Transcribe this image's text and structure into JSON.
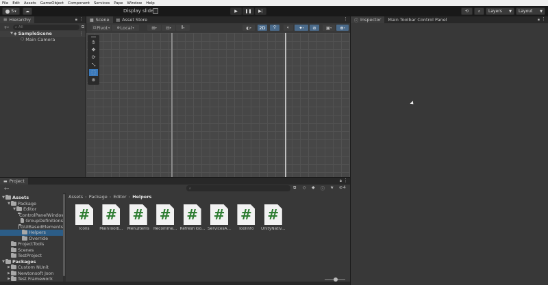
{
  "menu": [
    "File",
    "Edit",
    "Assets",
    "GameObject",
    "Component",
    "Services",
    "Pape",
    "Window",
    "Help"
  ],
  "toolbar": {
    "account_label": "S",
    "display_slider_label": "Display slider",
    "layers_label": "Layers",
    "layout_label": "Layout",
    "play_icon": "play-icon",
    "pause_icon": "pause-icon",
    "step_icon": "step-icon"
  },
  "hierarchy": {
    "tab_label": "Hierarchy",
    "search_placeholder": "All",
    "scene_name": "SampleScene",
    "items": [
      "Main Camera"
    ]
  },
  "scene": {
    "tabs": [
      "Scene",
      "Asset Store"
    ],
    "pivot_label": "Pivot",
    "local_label": "Local",
    "mode_2d_label": "2D"
  },
  "inspector": {
    "tab_label": "Inspector",
    "title": "Main Toolbar Control Panel"
  },
  "project": {
    "tab_label": "Project",
    "hidden_count": "4",
    "breadcrumb": [
      "Assets",
      "Package",
      "Editor",
      "Helpers"
    ],
    "tree": [
      {
        "label": "Assets",
        "level": 0,
        "bold": true,
        "expanded": true
      },
      {
        "label": "Package",
        "level": 1,
        "expanded": true
      },
      {
        "label": "Editor",
        "level": 2,
        "expanded": true
      },
      {
        "label": "ControlPanelWindow",
        "level": 3
      },
      {
        "label": "GroupDefinitions",
        "level": 3
      },
      {
        "label": "GUIBasedElements",
        "level": 3
      },
      {
        "label": "Helpers",
        "level": 3,
        "selected": true
      },
      {
        "label": "Override",
        "level": 3
      },
      {
        "label": "ProjectTools",
        "level": 1
      },
      {
        "label": "Scenes",
        "level": 1
      },
      {
        "label": "TestProject",
        "level": 1
      },
      {
        "label": "Packages",
        "level": 0,
        "bold": true,
        "expanded": true
      },
      {
        "label": "Custom NUnit",
        "level": 1,
        "collapsed": true
      },
      {
        "label": "Newtonsoft Json",
        "level": 1,
        "collapsed": true
      },
      {
        "label": "Test Framework",
        "level": 1,
        "collapsed": true
      }
    ],
    "assets": [
      "Icons",
      "MainToolb...",
      "MenuItems",
      "Recomme...",
      "RefreshToo...",
      "ServicesA...",
      "ToolInfo",
      "UnityNativ..."
    ],
    "file_glyph": "#"
  },
  "colors": {
    "accent_blue": "#3a79bb",
    "selection": "#2c5d87",
    "file_green": "#2e7d32",
    "panel_bg": "#383838",
    "viewport_bg": "#474747"
  }
}
